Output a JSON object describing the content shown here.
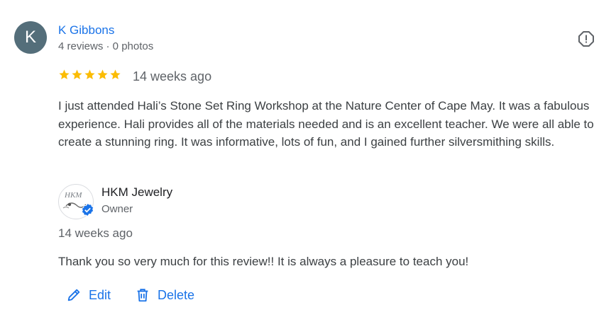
{
  "review": {
    "avatar_letter": "K",
    "reviewer_name": "K Gibbons",
    "reviewer_meta": "4 reviews · 0 photos",
    "rating": 5,
    "time": "14 weeks ago",
    "text": "I just attended Hali’s Stone Set Ring Workshop at the Nature Center of Cape May. It was a fabulous experience. Hali provides all of the materials needed and is an excellent teacher. We were all able to create a stunning ring. It was informative, lots of fun, and I gained further silversmithing skills."
  },
  "owner_reply": {
    "logo_text": "HKM",
    "owner_name": "HKM Jewelry",
    "owner_role": "Owner",
    "time": "14 weeks ago",
    "text": "Thank you so very much for this review!! It is always a pleasure to teach you!"
  },
  "actions": {
    "edit_label": "Edit",
    "delete_label": "Delete"
  },
  "colors": {
    "link": "#1a73e8",
    "star": "#fbbc04",
    "avatar_bg": "#546e7a",
    "text": "#3c4043",
    "secondary": "#5f6368"
  },
  "icons": {
    "report": "report-flag-icon",
    "star": "star-icon",
    "verified": "verified-badge-icon",
    "edit": "pencil-icon",
    "delete": "trash-icon"
  }
}
